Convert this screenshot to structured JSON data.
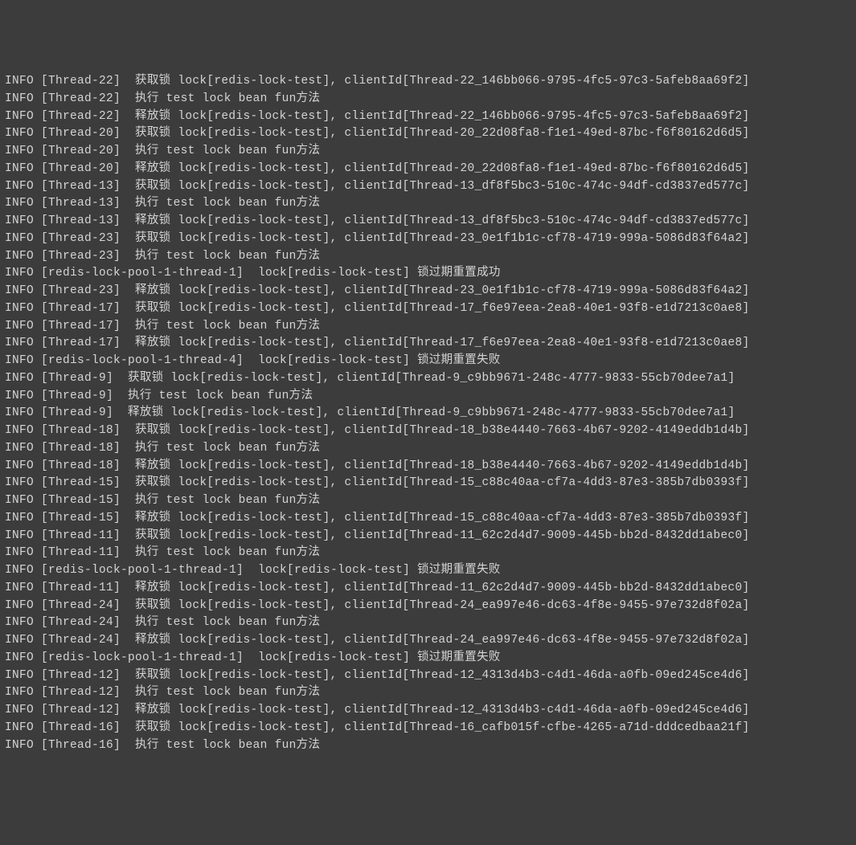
{
  "log_lines": [
    "INFO [Thread-22]  获取锁 lock[redis-lock-test], clientId[Thread-22_146bb066-9795-4fc5-97c3-5afeb8aa69f2]",
    "INFO [Thread-22]  执行 test lock bean fun方法",
    "INFO [Thread-22]  释放锁 lock[redis-lock-test], clientId[Thread-22_146bb066-9795-4fc5-97c3-5afeb8aa69f2]",
    "INFO [Thread-20]  获取锁 lock[redis-lock-test], clientId[Thread-20_22d08fa8-f1e1-49ed-87bc-f6f80162d6d5]",
    "INFO [Thread-20]  执行 test lock bean fun方法",
    "INFO [Thread-20]  释放锁 lock[redis-lock-test], clientId[Thread-20_22d08fa8-f1e1-49ed-87bc-f6f80162d6d5]",
    "INFO [Thread-13]  获取锁 lock[redis-lock-test], clientId[Thread-13_df8f5bc3-510c-474c-94df-cd3837ed577c]",
    "INFO [Thread-13]  执行 test lock bean fun方法",
    "INFO [Thread-13]  释放锁 lock[redis-lock-test], clientId[Thread-13_df8f5bc3-510c-474c-94df-cd3837ed577c]",
    "INFO [Thread-23]  获取锁 lock[redis-lock-test], clientId[Thread-23_0e1f1b1c-cf78-4719-999a-5086d83f64a2]",
    "INFO [Thread-23]  执行 test lock bean fun方法",
    "INFO [redis-lock-pool-1-thread-1]  lock[redis-lock-test] 锁过期重置成功",
    "INFO [Thread-23]  释放锁 lock[redis-lock-test], clientId[Thread-23_0e1f1b1c-cf78-4719-999a-5086d83f64a2]",
    "INFO [Thread-17]  获取锁 lock[redis-lock-test], clientId[Thread-17_f6e97eea-2ea8-40e1-93f8-e1d7213c0ae8]",
    "INFO [Thread-17]  执行 test lock bean fun方法",
    "INFO [Thread-17]  释放锁 lock[redis-lock-test], clientId[Thread-17_f6e97eea-2ea8-40e1-93f8-e1d7213c0ae8]",
    "INFO [redis-lock-pool-1-thread-4]  lock[redis-lock-test] 锁过期重置失败",
    "INFO [Thread-9]  获取锁 lock[redis-lock-test], clientId[Thread-9_c9bb9671-248c-4777-9833-55cb70dee7a1]",
    "INFO [Thread-9]  执行 test lock bean fun方法",
    "INFO [Thread-9]  释放锁 lock[redis-lock-test], clientId[Thread-9_c9bb9671-248c-4777-9833-55cb70dee7a1]",
    "INFO [Thread-18]  获取锁 lock[redis-lock-test], clientId[Thread-18_b38e4440-7663-4b67-9202-4149eddb1d4b]",
    "INFO [Thread-18]  执行 test lock bean fun方法",
    "INFO [Thread-18]  释放锁 lock[redis-lock-test], clientId[Thread-18_b38e4440-7663-4b67-9202-4149eddb1d4b]",
    "INFO [Thread-15]  获取锁 lock[redis-lock-test], clientId[Thread-15_c88c40aa-cf7a-4dd3-87e3-385b7db0393f]",
    "INFO [Thread-15]  执行 test lock bean fun方法",
    "INFO [Thread-15]  释放锁 lock[redis-lock-test], clientId[Thread-15_c88c40aa-cf7a-4dd3-87e3-385b7db0393f]",
    "INFO [Thread-11]  获取锁 lock[redis-lock-test], clientId[Thread-11_62c2d4d7-9009-445b-bb2d-8432dd1abec0]",
    "INFO [Thread-11]  执行 test lock bean fun方法",
    "INFO [redis-lock-pool-1-thread-1]  lock[redis-lock-test] 锁过期重置失败",
    "INFO [Thread-11]  释放锁 lock[redis-lock-test], clientId[Thread-11_62c2d4d7-9009-445b-bb2d-8432dd1abec0]",
    "INFO [Thread-24]  获取锁 lock[redis-lock-test], clientId[Thread-24_ea997e46-dc63-4f8e-9455-97e732d8f02a]",
    "INFO [Thread-24]  执行 test lock bean fun方法",
    "INFO [Thread-24]  释放锁 lock[redis-lock-test], clientId[Thread-24_ea997e46-dc63-4f8e-9455-97e732d8f02a]",
    "INFO [redis-lock-pool-1-thread-1]  lock[redis-lock-test] 锁过期重置失败",
    "INFO [Thread-12]  获取锁 lock[redis-lock-test], clientId[Thread-12_4313d4b3-c4d1-46da-a0fb-09ed245ce4d6]",
    "INFO [Thread-12]  执行 test lock bean fun方法",
    "INFO [Thread-12]  释放锁 lock[redis-lock-test], clientId[Thread-12_4313d4b3-c4d1-46da-a0fb-09ed245ce4d6]",
    "INFO [Thread-16]  获取锁 lock[redis-lock-test], clientId[Thread-16_cafb015f-cfbe-4265-a71d-dddcedbaa21f]",
    "INFO [Thread-16]  执行 test lock bean fun方法"
  ]
}
